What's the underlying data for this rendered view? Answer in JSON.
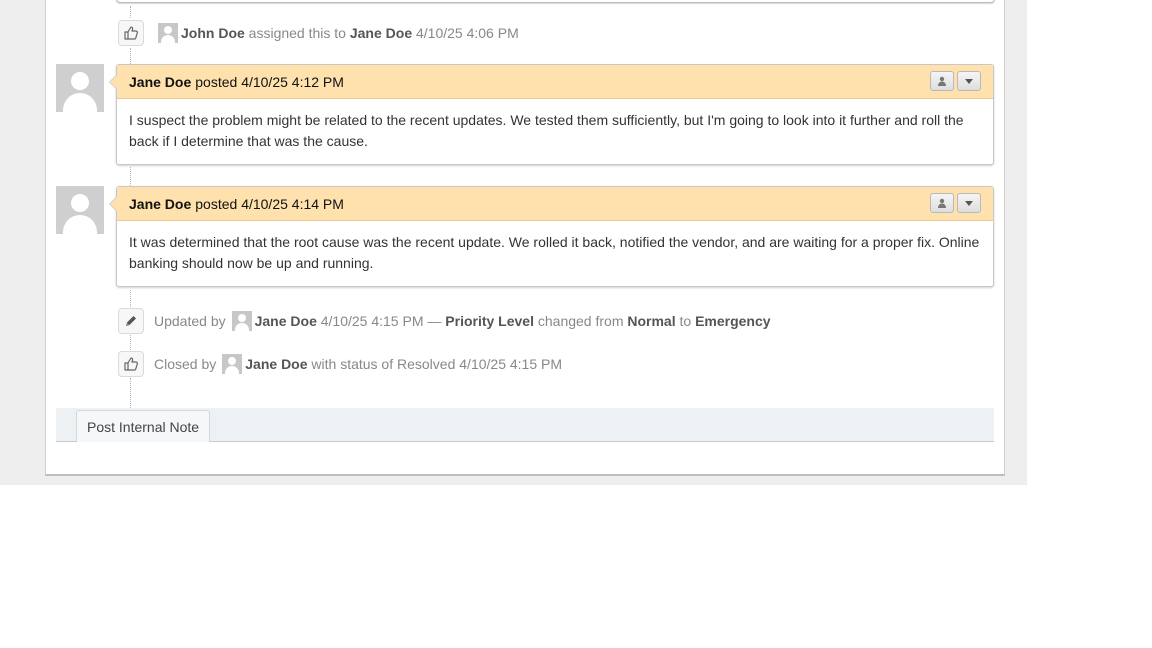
{
  "timeline": {
    "assigned": {
      "actor": "John Doe",
      "action": "assigned this to",
      "target": "Jane Doe",
      "timestamp": "4/10/25 4:06 PM",
      "icon": "thumbs-up-icon"
    },
    "notes": [
      {
        "author": "Jane Doe",
        "verb": "posted",
        "timestamp": "4/10/25 4:12 PM",
        "body": "I suspect the problem might be related to the recent updates. We tested them sufficiently, but I'm going to look into it further and roll the back if I determine that was the cause."
      },
      {
        "author": "Jane Doe",
        "verb": "posted",
        "timestamp": "4/10/25 4:14 PM",
        "body": "It was determined that the root cause was the recent update. We rolled it back, notified the vendor, and are waiting for a proper fix. Online banking should now be up and running."
      }
    ],
    "updated": {
      "prefix": "Updated by",
      "actor": "Jane Doe",
      "timestamp": "4/10/25 4:15 PM",
      "dash": "—",
      "field": "Priority Level",
      "changed_from": "changed from",
      "old_value": "Normal",
      "to": "to",
      "new_value": "Emergency",
      "icon": "pencil-icon"
    },
    "closed": {
      "prefix": "Closed by",
      "actor": "Jane Doe",
      "status_text": "with status of Resolved",
      "timestamp": "4/10/25 4:15 PM",
      "icon": "thumbs-up-icon"
    }
  },
  "actions": {
    "post_internal_note": "Post Internal Note"
  },
  "colors": {
    "note_header": "#fee1ad",
    "action_bar": "#eef1f4"
  }
}
